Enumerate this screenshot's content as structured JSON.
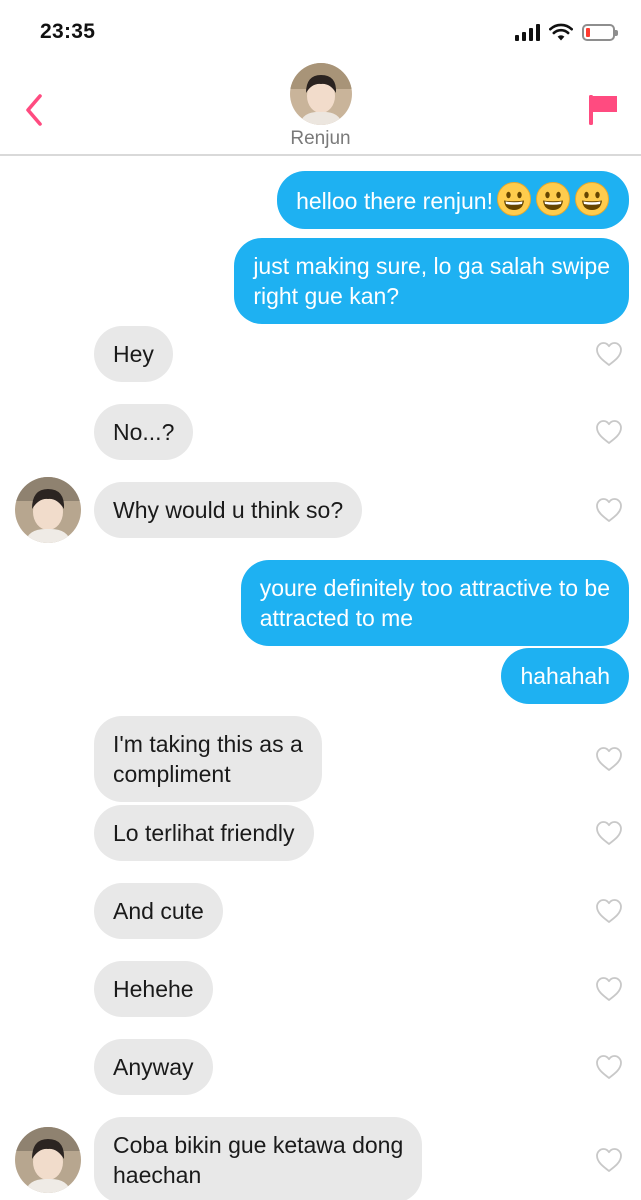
{
  "status_bar": {
    "time": "23:35",
    "signal_icon": "cellular-signal-icon",
    "wifi_icon": "wifi-icon",
    "battery_icon": "battery-low-icon",
    "battery_level": 0.15,
    "battery_color": "#ff3b30"
  },
  "header": {
    "contact_name": "Renjun",
    "back_icon": "chevron-left-icon",
    "report_icon": "flag-icon",
    "accent_color": "#ff4b80"
  },
  "colors": {
    "outgoing_bubble": "#1eb1f2",
    "incoming_bubble": "#e8e8e8",
    "heart_outline": "#c8c8c8"
  },
  "messages": [
    {
      "direction": "out",
      "text": "helloo there renjun!",
      "emoji": [
        "grinning-face-emoji",
        "grinning-face-emoji",
        "grinning-face-emoji"
      ]
    },
    {
      "direction": "out",
      "lines": [
        "just making sure, lo ga salah swipe",
        "right gue kan?"
      ]
    },
    {
      "direction": "in",
      "text": "Hey"
    },
    {
      "direction": "in",
      "text": "No...?"
    },
    {
      "direction": "in",
      "text": "Why would u think so?",
      "avatar": true
    },
    {
      "direction": "out",
      "lines": [
        "youre definitely too attractive to be",
        "attracted to me"
      ]
    },
    {
      "direction": "out",
      "text": "hahahah"
    },
    {
      "direction": "in",
      "lines": [
        "I'm taking this as a",
        "compliment"
      ]
    },
    {
      "direction": "in",
      "text": "Lo terlihat friendly"
    },
    {
      "direction": "in",
      "text": "And cute"
    },
    {
      "direction": "in",
      "text": "Hehehe"
    },
    {
      "direction": "in",
      "text": "Anyway"
    },
    {
      "direction": "in",
      "lines": [
        "Coba bikin gue ketawa dong",
        "haechan"
      ],
      "avatar": true
    }
  ]
}
